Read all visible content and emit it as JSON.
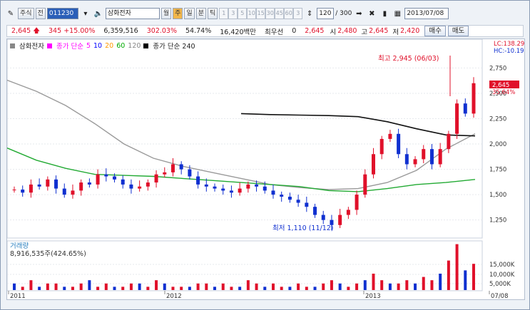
{
  "toolbar": {
    "market": "주식",
    "market_sub": "전",
    "code": "011230",
    "stock_name": "삼화전자",
    "interval_buttons": [
      "월",
      "주",
      "일",
      "분",
      "틱"
    ],
    "periods": [
      "1",
      "3",
      "5",
      "10",
      "15",
      "30",
      "45",
      "60",
      "3"
    ],
    "count_input": "120",
    "count_total": "/ 300",
    "date": "2013/07/08"
  },
  "info": {
    "price": "2,645",
    "change": "345",
    "change_pct": "+15.00%",
    "volume": "6,359,516",
    "volume_ratio": "302.03%",
    "turnover": "54.74%",
    "amount": "16,420백만",
    "pref_label": "최우선",
    "pref_value": "0",
    "last": "2,645",
    "open_label": "시",
    "open": "2,480",
    "high_label": "고",
    "high": "2,645",
    "low_label": "저",
    "low": "2,420",
    "buy_label": "매수",
    "sell_label": "매도"
  },
  "legend": {
    "name": "삼화전자",
    "ma_label": "종가 단순",
    "ma_periods": [
      "5",
      "10",
      "20",
      "60",
      "120"
    ],
    "ma240_label": "종가 단순 240"
  },
  "annotations": {
    "high": "최고 2,945 (06/03)",
    "low": "최저 1,110 (11/12)",
    "lc": "LC:138.29",
    "hc": "HC:-10.19",
    "current_price": "2,645",
    "current_pct": "35.64%"
  },
  "volume_panel": {
    "title": "거래량",
    "value": "8,916,535주(424.65%)"
  },
  "colors": {
    "up": "#e0102a",
    "down": "#1030d0",
    "ma5": "#ff00ff",
    "ma10": "#0000ff",
    "ma20": "#ff9900",
    "ma60": "#00aa00",
    "ma120": "#888888",
    "ma240": "#000000"
  },
  "chart_data": {
    "type": "line",
    "x_labels": [
      "2011",
      "2012",
      "2013",
      "07/08"
    ],
    "y_ticks": [
      1250,
      1500,
      1750,
      2000,
      2250,
      2500,
      2750
    ],
    "ylim": [
      1100,
      2950
    ],
    "volume_ticks": [
      "5,000K",
      "10,000K",
      "15,000K"
    ],
    "series": [
      {
        "name": "종가 단순 120",
        "values": [
          2630,
          2520,
          2380,
          2200,
          2000,
          1860,
          1780,
          1720,
          1660,
          1600,
          1570,
          1550,
          1560,
          1620,
          1740,
          1950,
          2100
        ]
      },
      {
        "name": "종가 단순 240",
        "values": [
          null,
          null,
          null,
          null,
          null,
          null,
          null,
          null,
          2300,
          2290,
          2285,
          2280,
          2270,
          2220,
          2150,
          2090,
          2080
        ]
      },
      {
        "name": "종가 단순 60",
        "values": [
          1960,
          1840,
          1760,
          1700,
          1690,
          1680,
          1660,
          1640,
          1620,
          1600,
          1580,
          1540,
          1530,
          1560,
          1600,
          1620,
          1650
        ]
      }
    ]
  }
}
